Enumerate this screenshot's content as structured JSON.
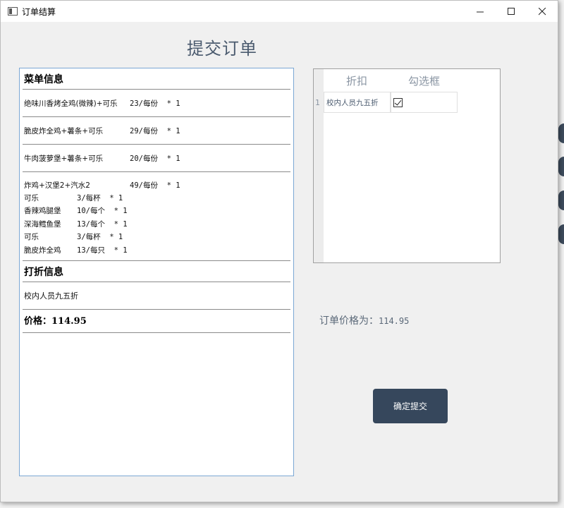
{
  "window": {
    "title": "订单结算",
    "minimize": "—",
    "close": "✕"
  },
  "heading": "提交订单",
  "info": {
    "menu_title": "菜单信息",
    "items": [
      {
        "name": "绝味川香烤全鸡(微辣)+可乐",
        "price": "23/每份  * 1"
      },
      {
        "name": "脆皮炸全鸡+薯条+可乐",
        "price": "29/每份  * 1"
      },
      {
        "name": "牛肉菠萝堡+薯条+可乐",
        "price": "20/每份  * 1"
      }
    ],
    "combo": {
      "name": "炸鸡+汉堡2+汽水2",
      "price": "49/每份  * 1",
      "subs": [
        {
          "name": "可乐",
          "price": "3/每杯  * 1"
        },
        {
          "name": "香辣鸡腿堡",
          "price": "10/每个  * 1"
        },
        {
          "name": "深海鳕鱼堡",
          "price": "13/每个  * 1"
        },
        {
          "name": "可乐",
          "price": "3/每杯  * 1"
        },
        {
          "name": "脆皮炸全鸡",
          "price": "13/每只  * 1"
        }
      ]
    },
    "discount_title": "打折信息",
    "discount_text": "校内人员九五折",
    "price_text": "价格：114.95"
  },
  "discount_table": {
    "headers": [
      "折扣",
      "勾选框"
    ],
    "rows": [
      {
        "num": "1",
        "name": "校内人员九五折",
        "checked": true
      }
    ]
  },
  "order_price": {
    "label": "订单价格为：",
    "value": "114.95"
  },
  "submit_label": "确定提交"
}
